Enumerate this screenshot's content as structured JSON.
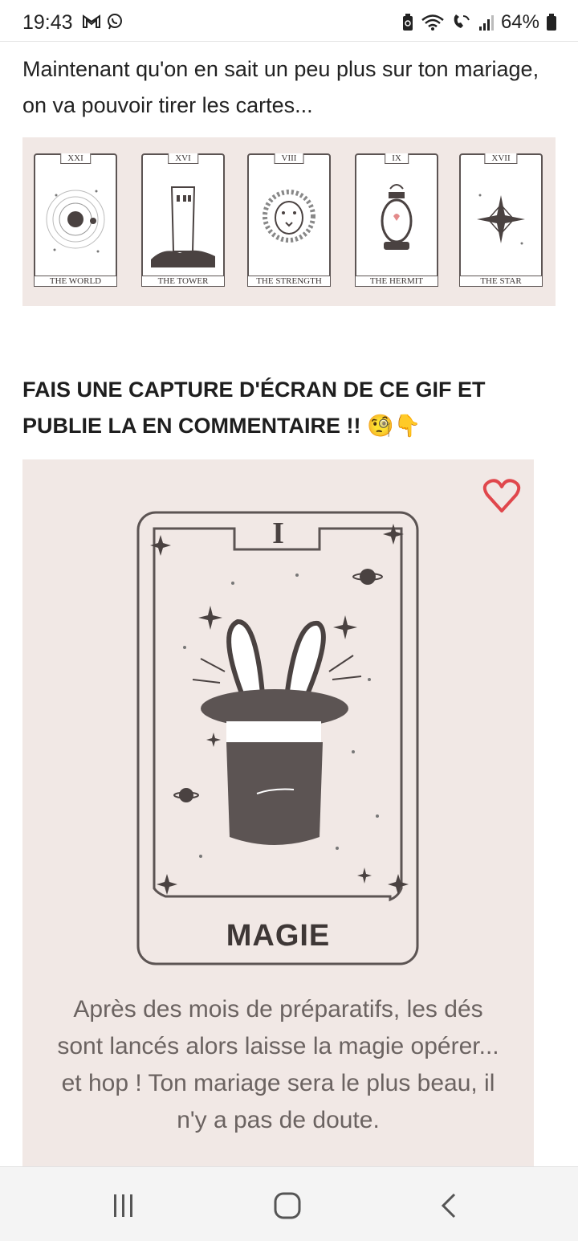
{
  "status": {
    "time": "19:43",
    "battery": "64%",
    "left_icons": [
      "gmail-icon",
      "whatsapp-icon"
    ],
    "right_icons": [
      "battery-saver-icon",
      "wifi-icon",
      "wifi-calling-icon",
      "signal-icon",
      "battery-icon"
    ]
  },
  "intro_text": "Maintenant qu'on en sait un peu plus sur ton mariage, on va pouvoir tirer les cartes...",
  "tarot_cards": [
    {
      "numeral": "XXI",
      "name": "THE WORLD",
      "icon": "planet-orbit-icon"
    },
    {
      "numeral": "XVI",
      "name": "THE TOWER",
      "icon": "tower-icon"
    },
    {
      "numeral": "VIII",
      "name": "THE STRENGTH",
      "icon": "lion-icon"
    },
    {
      "numeral": "IX",
      "name": "THE HERMIT",
      "icon": "lantern-icon"
    },
    {
      "numeral": "XVII",
      "name": "THE STAR",
      "icon": "star-icon"
    }
  ],
  "heading": "FAIS UNE CAPTURE D'ÉCRAN DE CE GIF ET PUBLIE LA EN COMMENTAIRE !! 🧐👇",
  "feature_card": {
    "numeral": "I",
    "title": "MAGIE",
    "text": "Après des mois de préparatifs, les dés sont lancés alors laisse la magie opérer... et hop ! Ton mariage sera le plus beau, il n'y a pas de doute.",
    "icon": "magic-hat-icon"
  },
  "colors": {
    "panel_bg": "#f1e8e5",
    "card_ink": "#5c5453",
    "heart": "#e0474c"
  },
  "nav": [
    "recents-icon",
    "home-icon",
    "back-icon"
  ]
}
